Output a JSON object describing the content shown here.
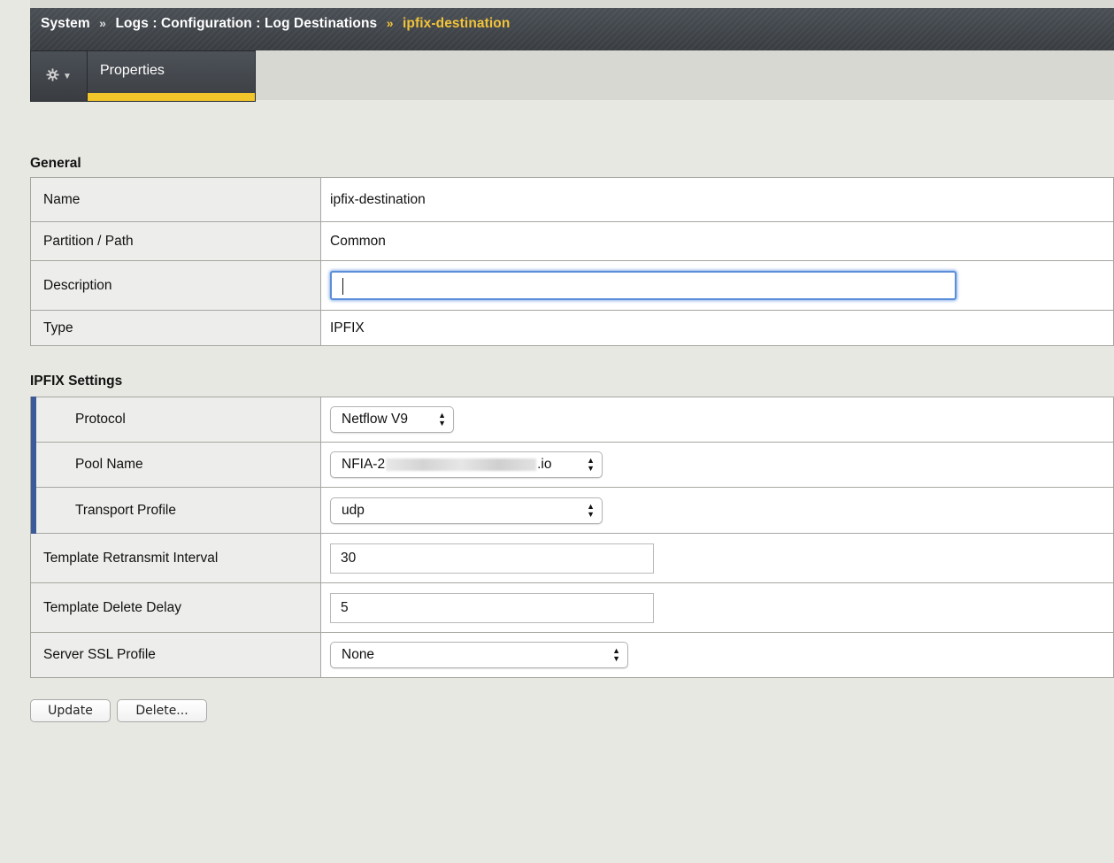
{
  "breadcrumb": {
    "items": [
      "System",
      "Logs : Configuration : Log Destinations"
    ],
    "separator": "»",
    "current": "ipfix-destination"
  },
  "tabs": {
    "gear_icon": "gear-icon",
    "properties_label": "Properties"
  },
  "general": {
    "title": "General",
    "rows": {
      "name": {
        "label": "Name",
        "value": "ipfix-destination"
      },
      "partition": {
        "label": "Partition / Path",
        "value": "Common"
      },
      "description": {
        "label": "Description",
        "value": ""
      },
      "type": {
        "label": "Type",
        "value": "IPFIX"
      }
    }
  },
  "ipfix": {
    "title": "IPFIX Settings",
    "rows": {
      "protocol": {
        "label": "Protocol",
        "selected": "Netflow V9"
      },
      "pool_name": {
        "label": "Pool Name",
        "selected_prefix": "NFIA-2",
        "selected_suffix": ".io"
      },
      "transport_profile": {
        "label": "Transport Profile",
        "selected": "udp"
      },
      "retransmit_interval": {
        "label": "Template Retransmit Interval",
        "value": "30"
      },
      "delete_delay": {
        "label": "Template Delete Delay",
        "value": "5"
      },
      "server_ssl_profile": {
        "label": "Server SSL Profile",
        "selected": "None"
      }
    }
  },
  "actions": {
    "update_label": "Update",
    "delete_label": "Delete..."
  },
  "colors": {
    "accent": "#f2c62b",
    "required_marker": "#3b5a9a",
    "title_bar": "#3f4348"
  }
}
